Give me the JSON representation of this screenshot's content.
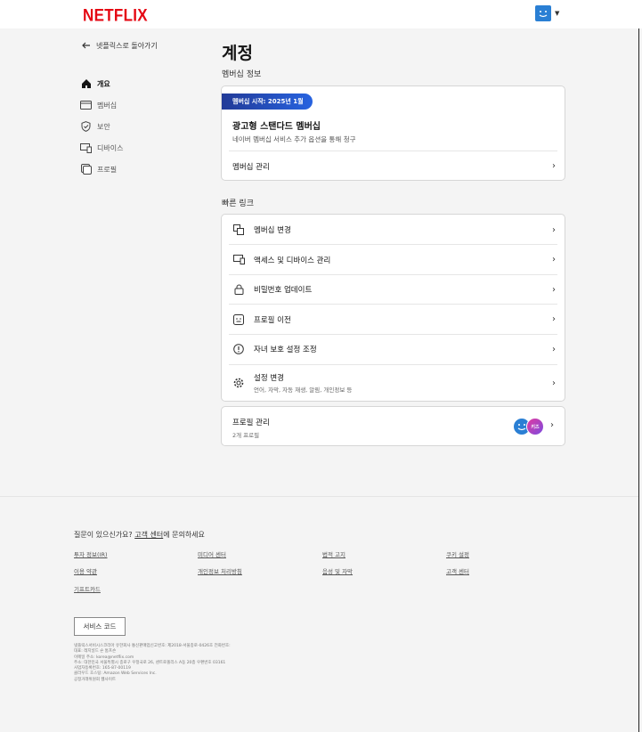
{
  "header": {
    "logo": "NETFLIX"
  },
  "back": {
    "label": "넷플릭스로 돌아가기"
  },
  "nav": [
    {
      "label": "개요"
    },
    {
      "label": "멤버십"
    },
    {
      "label": "보안"
    },
    {
      "label": "디바이스"
    },
    {
      "label": "프로필"
    }
  ],
  "main": {
    "title": "계정",
    "membership_section": "멤버십 정보",
    "badge": "멤버십 시작: 2025년 1월",
    "plan_name": "광고형 스탠다드 멤버십",
    "plan_desc": "네이버 멤버십 서비스 추가 옵션을 통해 청구",
    "manage_membership": "멤버십 관리",
    "quick_links_section": "빠른 링크",
    "quick_links": [
      {
        "label": "멤버십 변경",
        "icon": "swap-icon"
      },
      {
        "label": "액세스 및 디바이스 관리",
        "icon": "devices-icon"
      },
      {
        "label": "비밀번호 업데이트",
        "icon": "lock-icon"
      },
      {
        "label": "프로필 이전",
        "icon": "profile-transfer-icon"
      },
      {
        "label": "자녀 보호 설정 조정",
        "icon": "warning-icon"
      },
      {
        "label": "설정 변경",
        "sub": "언어, 자막, 자동 재생, 알림, 개인정보 등",
        "icon": "gear-icon"
      }
    ],
    "profiles": {
      "label": "프로필 관리",
      "count": "2개 프로필",
      "kids_label": "키즈"
    }
  },
  "footer": {
    "question": "질문이 있으신가요?",
    "contact_link": "고객 센터",
    "question_tail": "에 문의하세요",
    "links": [
      "투자 정보(IR)",
      "미디어 센터",
      "법적 고지",
      "쿠키 설정",
      "이용 약관",
      "개인정보 처리방침",
      "음성 및 자막",
      "고객 센터",
      "기프트카드"
    ],
    "service_code": "서비스 코드",
    "legal": [
      "넷플릭스서비시스코리아 유한회사 통신판매업신고번호: 제2018-서울종로-0426호 전화번호:",
      "대표: 레지널드 숀 톰프슨",
      "이메일 주소: korea@netflix.com",
      "주소: 대한민국 서울특별시 종로구 우정국로 26, 센트로폴리스 A동 20층 우편번호 03161",
      "사업자등록번호: 165-87-00119",
      "클라우드 호스팅: Amazon Web Services Inc.",
      "공정거래위원회 웹사이트"
    ]
  },
  "colors": {
    "brand": "#e50914",
    "badge_start": "#223a97",
    "badge_end": "#2763e0",
    "avatar_blue": "#2a7fd4"
  }
}
